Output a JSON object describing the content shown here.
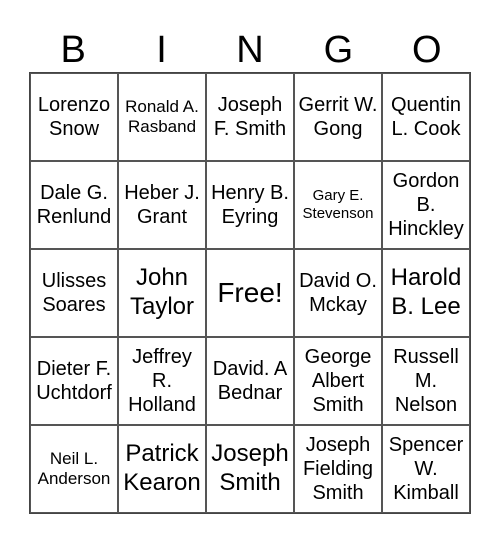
{
  "header": {
    "letters": [
      "B",
      "I",
      "N",
      "G",
      "O"
    ]
  },
  "card": {
    "rows": [
      [
        {
          "text": "Lorenzo Snow",
          "size": "md"
        },
        {
          "text": "Ronald A. Rasband",
          "size": "sm"
        },
        {
          "text": "Joseph F. Smith",
          "size": "md"
        },
        {
          "text": "Gerrit W. Gong",
          "size": "md"
        },
        {
          "text": "Quentin L. Cook",
          "size": "md"
        }
      ],
      [
        {
          "text": "Dale G. Renlund",
          "size": "md"
        },
        {
          "text": "Heber J. Grant",
          "size": "md"
        },
        {
          "text": "Henry B. Eyring",
          "size": "md"
        },
        {
          "text": "Gary E. Stevenson",
          "size": "xs"
        },
        {
          "text": "Gordon B. Hinckley",
          "size": "md"
        }
      ],
      [
        {
          "text": "Ulisses Soares",
          "size": "md"
        },
        {
          "text": "John Taylor",
          "size": "lg"
        },
        {
          "text": "Free!",
          "size": "xl"
        },
        {
          "text": "David O. Mckay",
          "size": "md"
        },
        {
          "text": "Harold B. Lee",
          "size": "lg"
        }
      ],
      [
        {
          "text": "Dieter F. Uchtdorf",
          "size": "md"
        },
        {
          "text": "Jeffrey R. Holland",
          "size": "md"
        },
        {
          "text": "David. A Bednar",
          "size": "md"
        },
        {
          "text": "George Albert Smith",
          "size": "md"
        },
        {
          "text": "Russell M. Nelson",
          "size": "md"
        }
      ],
      [
        {
          "text": "Neil L. Anderson",
          "size": "sm"
        },
        {
          "text": "Patrick Kearon",
          "size": "lg"
        },
        {
          "text": "Joseph Smith",
          "size": "lg"
        },
        {
          "text": "Joseph Fielding Smith",
          "size": "md"
        },
        {
          "text": "Spencer W. Kimball",
          "size": "md"
        }
      ]
    ]
  }
}
